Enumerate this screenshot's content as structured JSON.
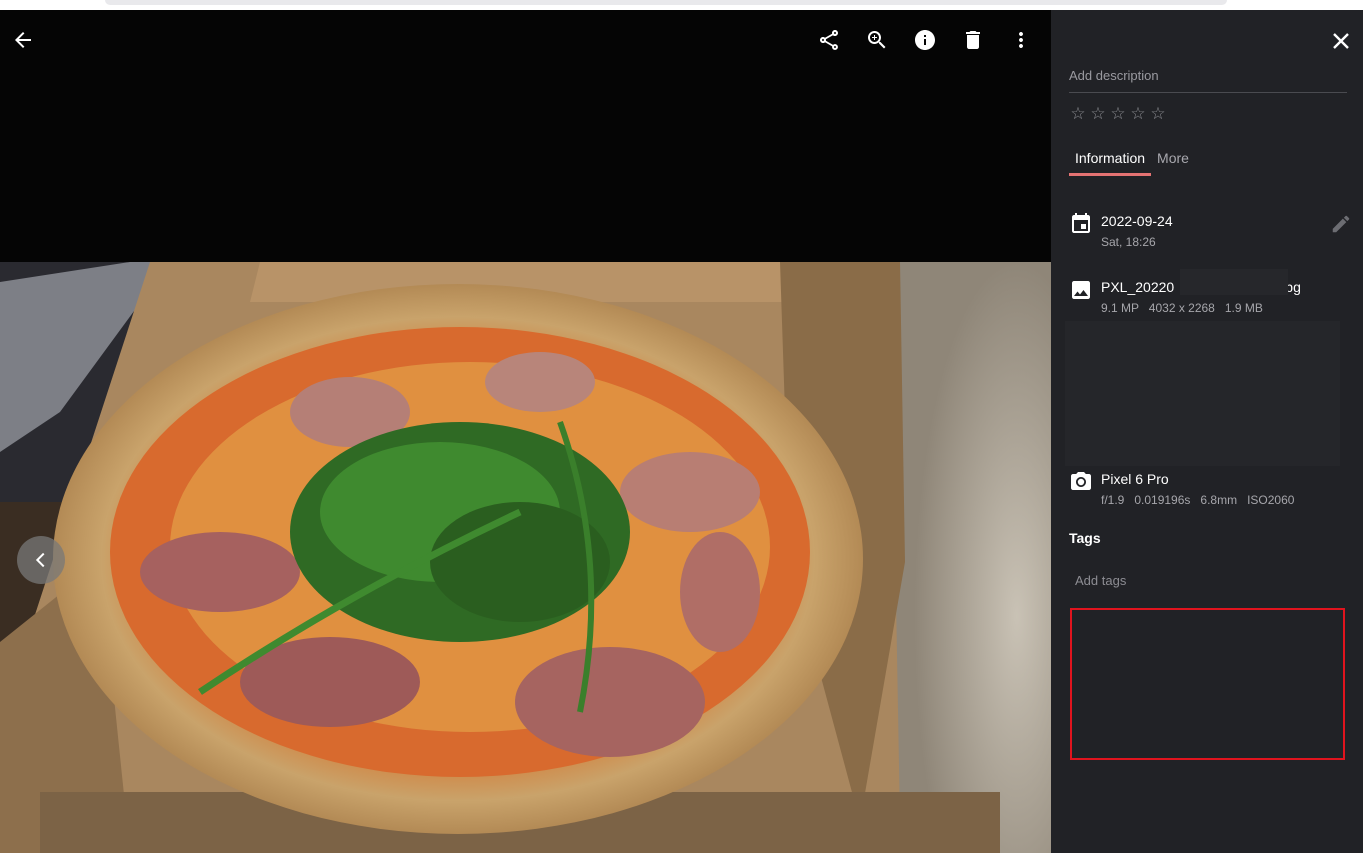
{
  "viewer": {
    "photo_description": "pizza",
    "prev_icon": "chevron-left-icon"
  },
  "toolbar": {
    "back_icon": "arrow-left-icon",
    "share_icon": "share-icon",
    "zoom_icon": "zoom-in-icon",
    "info_icon": "info-icon",
    "delete_icon": "delete-icon",
    "more_icon": "more-vert-icon"
  },
  "panel": {
    "close_icon": "close-icon",
    "description_placeholder": "Add description",
    "rating": {
      "max": 5,
      "value": 0,
      "stars": [
        "☆",
        "☆",
        "☆",
        "☆",
        "☆"
      ]
    },
    "tabs": [
      {
        "label": "Information",
        "active": true
      },
      {
        "label": "More",
        "active": false
      }
    ],
    "date": {
      "primary": "2022-09-24",
      "secondary": "Sat, 18:26",
      "icon": "calendar-icon"
    },
    "file": {
      "name_prefix": "PXL_20220",
      "name_suffix": "jpg",
      "details": "9.1 MP   4032 x 2268   1.9 MB",
      "icon": "image-icon"
    },
    "camera": {
      "model": "Pixel 6 Pro",
      "details": "f/1.9   0.019196s   6.8mm   ISO2060",
      "icon": "camera-icon"
    },
    "tags": {
      "title": "Tags",
      "placeholder": "Add tags"
    }
  },
  "colors": {
    "panel_bg": "#212226",
    "accent": "#e57373",
    "highlight_box": "#e0141e"
  }
}
